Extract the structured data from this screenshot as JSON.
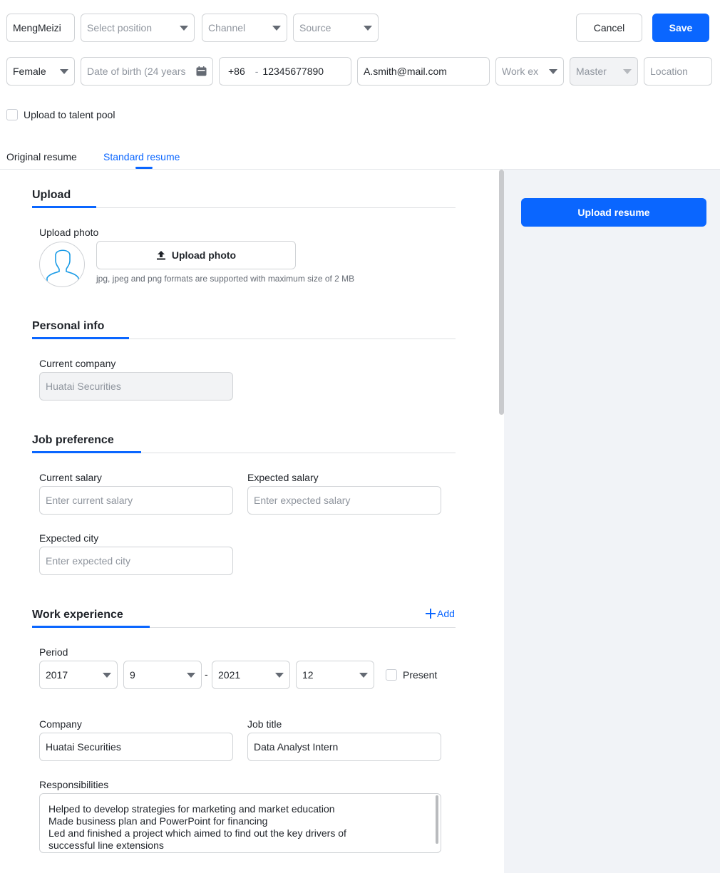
{
  "header": {
    "name_value": "MengMeizi",
    "position_placeholder": "Select position",
    "channel_placeholder": "Channel",
    "source_placeholder": "Source",
    "cancel_label": "Cancel",
    "save_label": "Save",
    "gender_value": "Female",
    "dob_placeholder": "Date of birth (24 years",
    "phone_code": "+86",
    "phone_sep": "-",
    "phone_value": "12345677890",
    "email_value": "A.smith@mail.com",
    "work_exp_placeholder": "Work ex",
    "degree_value": "Master",
    "location_placeholder": "Location",
    "talent_pool_label": "Upload to talent pool"
  },
  "tabs": [
    {
      "label": "Original resume",
      "active": false
    },
    {
      "label": "Standard resume",
      "active": true
    }
  ],
  "upload": {
    "title": "Upload",
    "photo_label": "Upload photo",
    "photo_button": "Upload photo",
    "help": "jpg, jpeg and png formats are supported with maximum size of 2 MB"
  },
  "personal": {
    "title": "Personal info",
    "company_label": "Current company",
    "company_value": "Huatai Securities"
  },
  "job_pref": {
    "title": "Job preference",
    "current_salary_label": "Current salary",
    "current_salary_placeholder": "Enter current salary",
    "expected_salary_label": "Expected salary",
    "expected_salary_placeholder": "Enter expected salary",
    "expected_city_label": "Expected city",
    "expected_city_placeholder": "Enter expected city"
  },
  "work": {
    "title": "Work experience",
    "add_label": "Add",
    "period_label": "Period",
    "start_year": "2017",
    "start_month": "9",
    "range_sep": "-",
    "end_year": "2021",
    "end_month": "12",
    "present_label": "Present",
    "company_label": "Company",
    "company_value": "Huatai Securities",
    "job_title_label": "Job title",
    "job_title_value": "Data Analyst Intern",
    "responsibilities_label": "Responsibilities",
    "responsibilities_lines": [
      "Helped to develop strategies for marketing and market education",
      "Made business plan and PowerPoint for financing",
      "Led and finished a project which aimed to find out the key drivers of",
      "successful line extensions"
    ]
  },
  "sidebar": {
    "upload_resume_label": "Upload resume"
  },
  "colors": {
    "primary": "#0a66ff",
    "panel_bg": "#f1f3f7",
    "border": "#d0d3d6"
  }
}
